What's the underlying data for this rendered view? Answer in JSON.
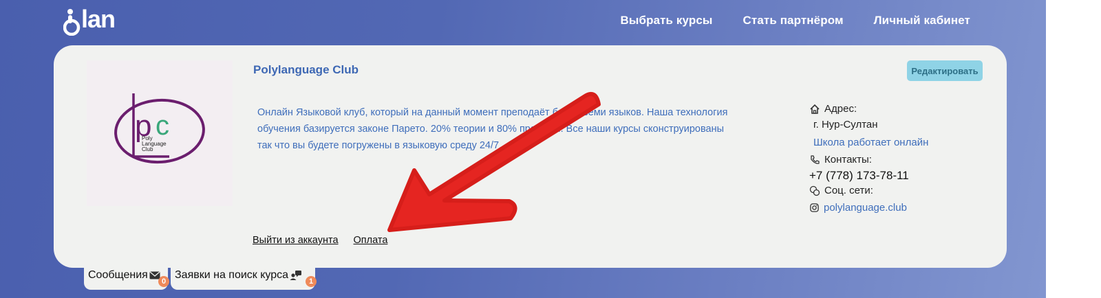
{
  "header": {
    "logo_text": "olan",
    "nav": [
      {
        "label": "Выбрать курсы"
      },
      {
        "label": "Стать партнёром"
      },
      {
        "label": "Личный кабинет"
      }
    ]
  },
  "school": {
    "name": "Polylanguage Club",
    "edit_label": "Редактировать",
    "logo": {
      "letters": "PC",
      "lines": [
        "Poly",
        "Language",
        "Club"
      ]
    },
    "description": "Онлайн Языковой клуб, который на данный момент преподаёт более семи языков. Наша технология обучения базируется законе Парето. 20% теории и 80% практики. Все наши курсы сконструированы так что вы будете погружены в языковую среду 24/7."
  },
  "contacts": {
    "address_label": "Адрес:",
    "city": "г. Нур-Султан",
    "online_note": "Школа работает онлайн",
    "contacts_label": "Контакты:",
    "phone": "+7 (778) 173-78-11",
    "social_label": "Соц. сети:",
    "instagram": "polylanguage.club"
  },
  "links": {
    "logout": "Выйти из аккаунта",
    "payment": "Оплата"
  },
  "tabs": [
    {
      "label": "Сообщения",
      "count": "0"
    },
    {
      "label": "Заявки на поиск курса",
      "count": "1"
    }
  ],
  "colors": {
    "accent_blue": "#3f6ebb",
    "edit_button": "#8fd3e6",
    "badge": "#ef8a5a",
    "annotation_arrow": "#e52521"
  }
}
